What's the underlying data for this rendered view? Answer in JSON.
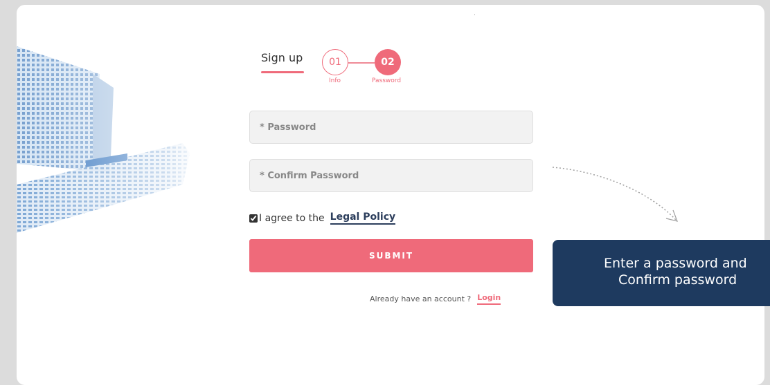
{
  "form": {
    "title": "Sign up",
    "steps": [
      {
        "number": "01",
        "label": "Info"
      },
      {
        "number": "02",
        "label": "Password"
      }
    ],
    "password_placeholder": "* Password",
    "confirm_placeholder": "* Confirm Password",
    "agree_text": "I agree to the",
    "legal_link": "Legal Policy",
    "submit_label": "SUBMIT",
    "already_text": "Already have an account ?",
    "login_link": "Login"
  },
  "tooltip": {
    "line1": "Enter a password and",
    "line2": "Confirm password"
  },
  "colors": {
    "accent": "#ef6a7a",
    "tooltip_bg": "#1e3a5f",
    "link_dark": "#2c3e5c"
  }
}
